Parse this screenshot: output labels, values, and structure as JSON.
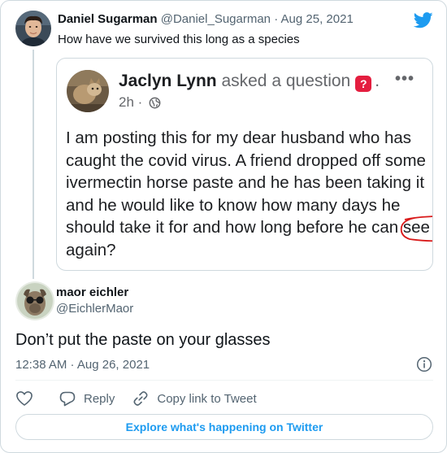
{
  "parent_tweet": {
    "display_name": "Daniel Sugarman",
    "handle": "@Daniel_Sugarman",
    "separator": "·",
    "date": "Aug 25, 2021",
    "text": "How have we survived this long as a species"
  },
  "embedded_post": {
    "author": "Jaclyn Lynn",
    "action": "asked a question",
    "question_icon": "?",
    "trailing_dot": ".",
    "more_label": "•••",
    "time": "2h",
    "meta_separator": "·",
    "body_before": "I am posting this for my dear husband who has caught the covid virus. A friend dropped off some ivermectin horse paste and he has been taking it and he would like to know how many days he should take it for and how long before he can ",
    "body_circled": "see again?",
    "circle_color": "#d91a1a"
  },
  "reply_tweet": {
    "display_name": "maor eichler",
    "handle": "@EichlerMaor",
    "text": "Don’t put the paste on your glasses",
    "timestamp": "12:38 AM · Aug 26, 2021"
  },
  "actions": {
    "reply_label": "Reply",
    "copy_link_label": "Copy link to Tweet"
  },
  "explore_label": "Explore what's happening on Twitter",
  "colors": {
    "twitter_blue": "#1d9bf0",
    "border": "#cfd9de",
    "muted_text": "#536471",
    "question_badge": "#e41e3f"
  }
}
